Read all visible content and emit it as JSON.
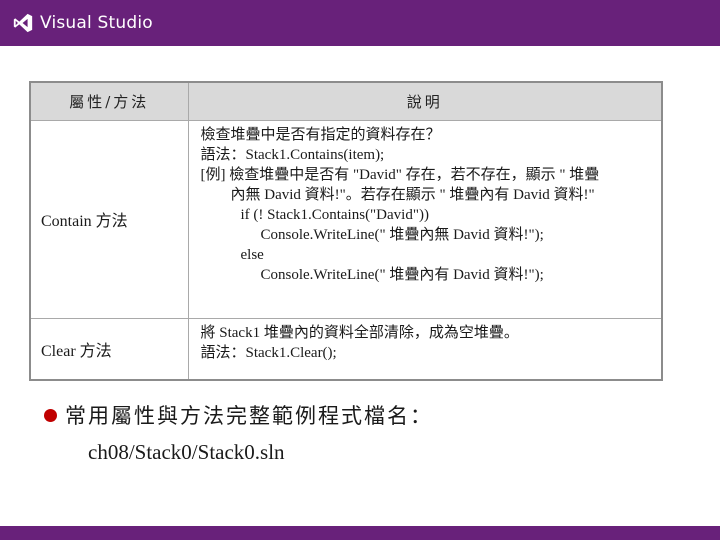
{
  "header": {
    "logo_text": "Visual Studio",
    "brand_color": "#68217a"
  },
  "table": {
    "headers": [
      "屬性/方法",
      "說明"
    ],
    "rows": [
      {
        "name": "Contain 方法",
        "lines": [
          "檢查堆疊中是否有指定的資料存在？",
          "語法：Stack1.Contains(item);",
          "[例] 檢查堆疊中是否有 \"David\" 存在，若不存在，顯示 \" 堆疊",
          "內無 David 資料!\"。若存在顯示 \" 堆疊內有 David 資料!\"",
          "if (! Stack1.Contains(\"David\"))",
          "Console.WriteLine(\" 堆疊內無 David 資料!\");",
          "else",
          "Console.WriteLine(\" 堆疊內有 David 資料!\");"
        ]
      },
      {
        "name": "Clear 方法",
        "lines": [
          "將 Stack1 堆疊內的資料全部清除，成為空堆疊。",
          "語法：Stack1.Clear();"
        ]
      }
    ]
  },
  "bullet": {
    "text": "常用屬性與方法完整範例程式檔名：",
    "path": "ch08/Stack0/Stack0.sln",
    "bullet_color": "#c00000"
  }
}
